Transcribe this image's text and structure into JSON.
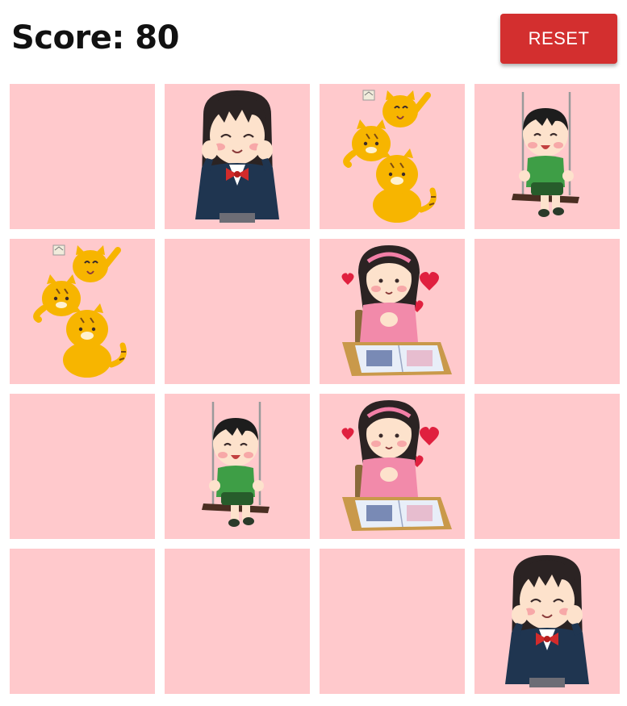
{
  "score_label": "Score: 80",
  "reset_label": "RESET",
  "colors": {
    "card_back": "#ffc9cc",
    "reset_bg": "#d32f2f",
    "score_text": "#111111"
  },
  "cards": [
    {
      "row": 1,
      "col": 1,
      "state": "hidden",
      "image": ""
    },
    {
      "row": 1,
      "col": 2,
      "state": "revealed",
      "image": "schoolgirl-smiling"
    },
    {
      "row": 1,
      "col": 3,
      "state": "revealed",
      "image": "stacked-tigers"
    },
    {
      "row": 1,
      "col": 4,
      "state": "revealed",
      "image": "boy-on-swing"
    },
    {
      "row": 2,
      "col": 1,
      "state": "revealed",
      "image": "stacked-tigers"
    },
    {
      "row": 2,
      "col": 2,
      "state": "hidden",
      "image": ""
    },
    {
      "row": 2,
      "col": 3,
      "state": "revealed",
      "image": "girl-with-photo-album"
    },
    {
      "row": 2,
      "col": 4,
      "state": "hidden",
      "image": ""
    },
    {
      "row": 3,
      "col": 1,
      "state": "hidden",
      "image": ""
    },
    {
      "row": 3,
      "col": 2,
      "state": "revealed",
      "image": "boy-on-swing"
    },
    {
      "row": 3,
      "col": 3,
      "state": "revealed",
      "image": "girl-with-photo-album"
    },
    {
      "row": 3,
      "col": 4,
      "state": "hidden",
      "image": ""
    },
    {
      "row": 4,
      "col": 1,
      "state": "hidden",
      "image": ""
    },
    {
      "row": 4,
      "col": 2,
      "state": "hidden",
      "image": ""
    },
    {
      "row": 4,
      "col": 3,
      "state": "hidden",
      "image": ""
    },
    {
      "row": 4,
      "col": 4,
      "state": "revealed",
      "image": "schoolgirl-smiling"
    }
  ]
}
